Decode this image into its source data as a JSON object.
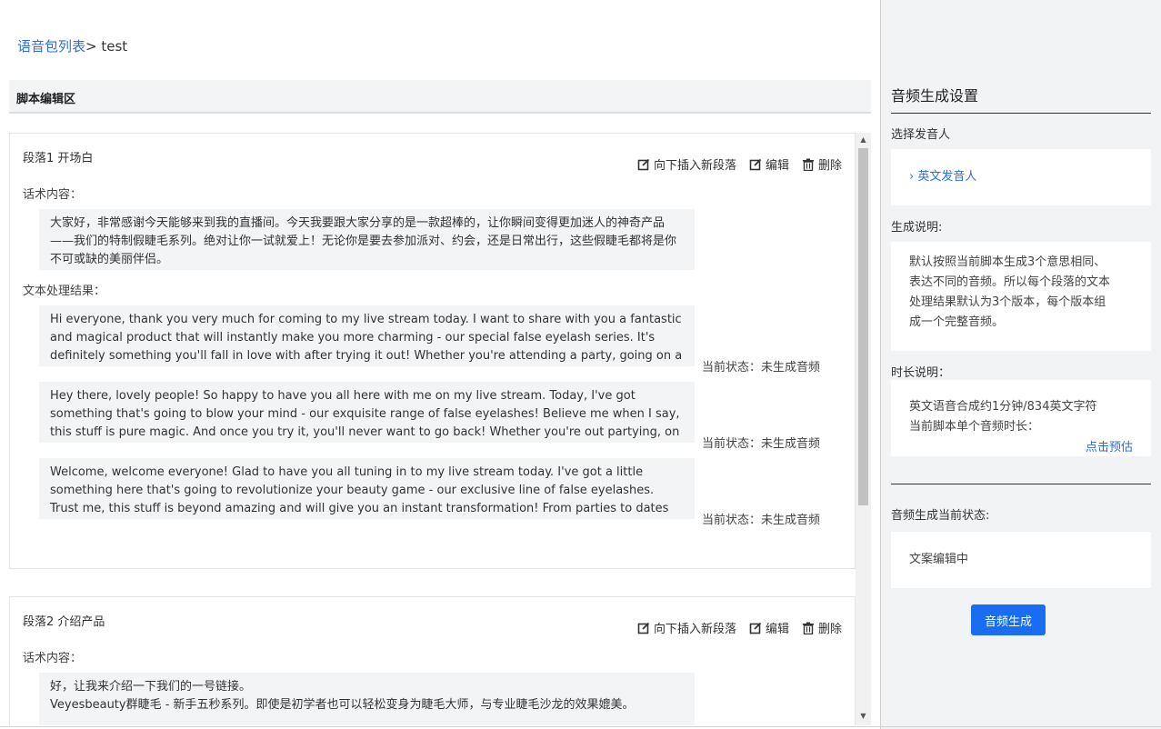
{
  "breadcrumb": {
    "link": "语音包列表",
    "separator": "> ",
    "current": "test"
  },
  "editor": {
    "title": "脚本编辑区",
    "actions": {
      "insert": "向下插入新段落",
      "edit": "编辑",
      "delete": "删除"
    },
    "script_label": "话术内容：",
    "result_label": "文本处理结果：",
    "status_text": "当前状态：未生成音频",
    "paragraphs": [
      {
        "title": "段落1 开场白",
        "script": "大家好，非常感谢今天能够来到我的直播间。今天我要跟大家分享的是一款超棒的，让你瞬间变得更加迷人的神奇产品——我们的特制假睫毛系列。绝对让你一试就爱上！无论你是要去参加派对、约会，还是日常出行，这些假睫毛都将是你不可或缺的美丽伴侣。",
        "results": [
          "Hi everyone, thank you very much for coming to my live stream today. I want to share with you a fantastic and magical product that will instantly make you more charming - our special false eyelash series. It's definitely something you'll fall in love with after trying it out! Whether you're attending a party, going on a date, or just",
          "Hey there, lovely people! So happy to have you all here with me on my live stream. Today, I've got something that's going to blow your mind - our exquisite range of false eyelashes! Believe me when I say, this stuff is pure magic. And once you try it, you'll never want to go back! Whether you're out partying, on a romantic evening, or",
          "Welcome, welcome everyone! Glad to have you all tuning in to my live stream today. I've got a little something here that's going to revolutionize your beauty game - our exclusive line of false eyelashes. Trust me, this stuff is beyond amazing and will give you an instant transformation! From parties to dates to everyday hustle, these"
        ]
      },
      {
        "title": "段落2 介绍产品",
        "script_lines": [
          "好，让我来介绍一下我们的一号链接。",
          "Veyesbeauty群睫毛 - 新手五秒系列。即使是初学者也可以轻松变身为睫毛大师，与专业睫毛沙龙的效果媲美。"
        ]
      }
    ]
  },
  "sidebar": {
    "title": "音频生成设置",
    "speaker_label": "选择发音人",
    "speaker_value": "› 英文发音人",
    "gen_desc_label": "生成说明:",
    "gen_desc_lines": [
      "默认按照当前脚本生成3个意思相同、",
      "表达不同的音频。所以每个段落的文本",
      "处理结果默认为3个版本，每个版本组",
      "成一个完整音频。"
    ],
    "duration_label": "时长说明：",
    "duration_lines": [
      "英文语音合成约1分钟/834英文字符",
      "当前脚本单个音频时长："
    ],
    "estimate_link": "点击预估",
    "status_label": "音频生成当前状态:",
    "status_value": "文案编辑中",
    "generate_button": "音频生成"
  }
}
